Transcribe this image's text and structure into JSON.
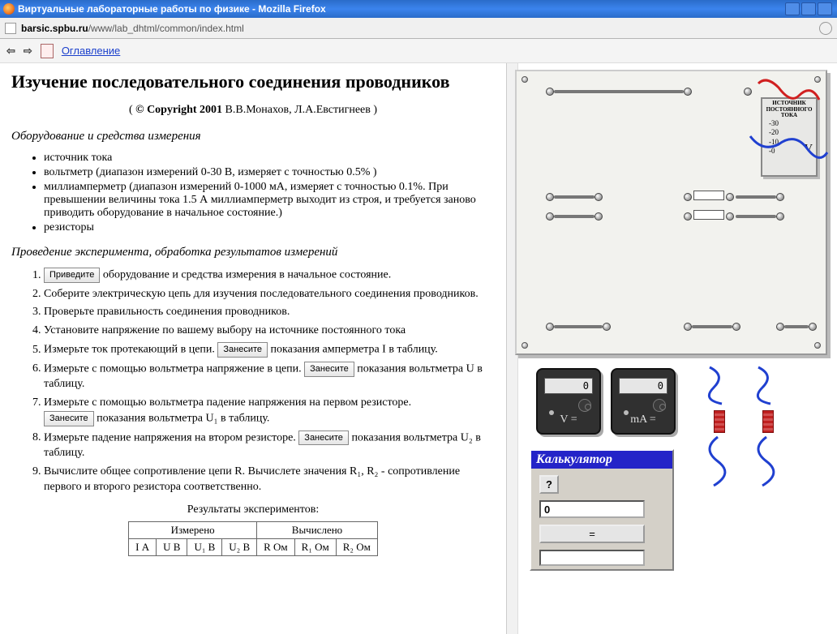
{
  "browser": {
    "title": "Виртуальные лабораторные работы по физике - Mozilla Firefox",
    "url_host": "barsic.spbu.ru",
    "url_path": "/www/lab_dhtml/common/index.html"
  },
  "toolbar": {
    "back": "⇦",
    "forward": "⇨",
    "toc": "Оглавление"
  },
  "content": {
    "title": "Изучение последовательного соединения проводников",
    "copyright_bold": "© Copyright 2001",
    "copyright_rest": " В.В.Монахов, Л.А.Евстигнеев )",
    "copyright_prefix": "( ",
    "section_equipment": "Оборудование и средства измерения",
    "equipment": [
      "источник тока",
      "вольтметр (диапазон измерений 0-30 В, измеряет с точностью 0.5% )",
      "миллиамперметр (диапазон измерений 0-1000 мА, измеряет с точностью 0.1%. При превышении величины тока 1.5 А миллиамперметр выходит из строя, и требуется заново приводить оборудование в начальное состояние.)",
      "резисторы"
    ],
    "section_procedure": "Проведение эксперимента, обработка результатов измерений",
    "btn_reset": "Приведите",
    "btn_record": "Занесите",
    "step1_tail": " оборудование и средства измерения в начальное состояние.",
    "step2": "Соберите электрическую цепь для изучения последовательного соединения проводников.",
    "step3": "Проверьте правильность соединения проводников.",
    "step4": "Установите напряжение по вашему выбору на источнике постоянного тока",
    "step5_a": "Измерьте ток протекающий в цепи. ",
    "step5_b": " показания амперметра I в таблицу.",
    "step6_a": "Измерьте с помощью вольтметра напряжение в цепи. ",
    "step6_b": " показания вольтметра U в таблицу.",
    "step7_a": "Измерьте с помощью вольтметра падение напряжения на первом резисторе. ",
    "step7_b": " показания вольтметра U₁ в таблицу.",
    "step8_a": "Измерьте падение напряжения на втором резисторе. ",
    "step8_b": " показания вольтметра U₂ в таблицу.",
    "step9": "Вычислите общее сопротивление цепи R. Вычислете значения R₁, R₂ - сопротивление первого и второго резистора соответственно.",
    "table_title": "Результаты экспериментов:",
    "table": {
      "group1": "Измерено",
      "group2": "Вычислено",
      "headers": [
        "I А",
        "U В",
        "U₁ В",
        "U₂ В",
        "R Ом",
        "R₁ Ом",
        "R₂ Ом"
      ]
    }
  },
  "apparatus": {
    "source_label1": "ИСТОЧНИК",
    "source_label2": "ПОСТОЯННОГО",
    "source_label3": "ТОКА",
    "scale": [
      "-30",
      "-20",
      "-10",
      "-0"
    ],
    "source_unit": "V",
    "voltmeter": {
      "reading": "0",
      "unit": "V ="
    },
    "ammeter": {
      "reading": "0",
      "unit": "mA ="
    }
  },
  "calculator": {
    "title": "Калькулятор",
    "help": "?",
    "display": "0",
    "eq": "="
  }
}
